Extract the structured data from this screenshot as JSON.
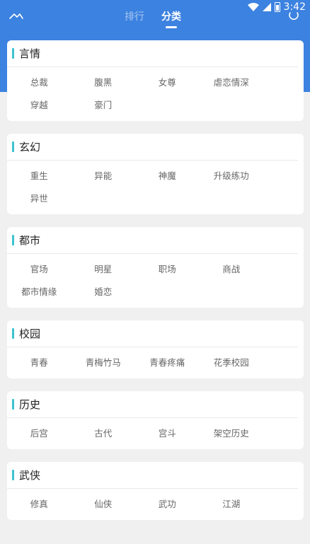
{
  "status": {
    "time": "3:42"
  },
  "header": {
    "tabs": [
      {
        "label": "排行",
        "active": false
      },
      {
        "label": "分类",
        "active": true
      }
    ]
  },
  "categories": [
    {
      "title": "言情",
      "tags": [
        "总裁",
        "腹黑",
        "女尊",
        "虐恋情深",
        "穿越",
        "豪门"
      ]
    },
    {
      "title": "玄幻",
      "tags": [
        "重生",
        "异能",
        "神魔",
        "升级练功",
        "异世"
      ]
    },
    {
      "title": "都市",
      "tags": [
        "官场",
        "明星",
        "职场",
        "商战",
        "都市情缘",
        "婚恋"
      ]
    },
    {
      "title": "校园",
      "tags": [
        "青春",
        "青梅竹马",
        "青春疼痛",
        "花季校园"
      ]
    },
    {
      "title": "历史",
      "tags": [
        "后宫",
        "古代",
        "宫斗",
        "架空历史"
      ]
    },
    {
      "title": "武侠",
      "tags": [
        "修真",
        "仙侠",
        "武功",
        "江湖"
      ]
    }
  ],
  "colors": {
    "header": "#3c82e0",
    "accent_bar": "#3cc3cf",
    "background": "#f0f0f0"
  }
}
